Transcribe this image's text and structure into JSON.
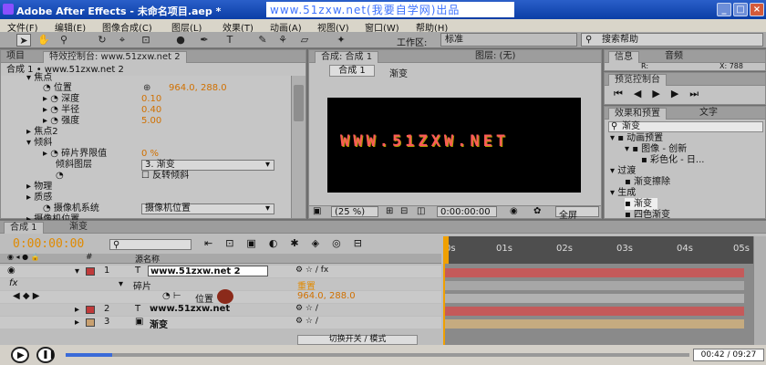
{
  "titlebar": {
    "title": "Adobe After Effects - 未命名项目.aep *",
    "watermark": "www.51zxw.net(我要自学网)出品",
    "buttons": [
      "_",
      "□",
      "×"
    ]
  },
  "menu": [
    "文件(F)",
    "编辑(E)",
    "图像合成(C)",
    "图层(L)",
    "效果(T)",
    "动画(A)",
    "视图(V)",
    "窗口(W)",
    "帮助(H)"
  ],
  "toolbar": {
    "workspace_label": "工作区:",
    "workspace_value": "标准",
    "search_help": "搜索帮助"
  },
  "left_panel": {
    "tabs": [
      "项目",
      "特效控制台: www.51zxw.net 2"
    ],
    "breadcrumb": "合成 1 • www.51zxw.net 2",
    "rows": [
      {
        "label": "焦点",
        "value": ""
      },
      {
        "label": "位置",
        "value": "964.0, 288.0"
      },
      {
        "label": "深度",
        "value": "0.10"
      },
      {
        "label": "半径",
        "value": "0.40"
      },
      {
        "label": "强度",
        "value": "5.00"
      },
      {
        "label": "焦点2",
        "value": ""
      },
      {
        "label": "倾斜",
        "value": ""
      },
      {
        "label": "碎片界限值",
        "value": "0 %"
      },
      {
        "label": "倾斜图层",
        "value": "3. 渐变"
      },
      {
        "label": "反转倾斜",
        "value": ""
      },
      {
        "label": "物理",
        "value": ""
      },
      {
        "label": "质感",
        "value": ""
      },
      {
        "label": "摄像机系统",
        "value": "摄像机位置"
      },
      {
        "label": "摄像机位置",
        "value": ""
      }
    ]
  },
  "comp_panel": {
    "tabs": [
      "合成: 合成 1",
      "图层: (无)"
    ],
    "subtabs": [
      "合成 1",
      "渐变"
    ],
    "canvas_text": "WWW.51ZXW.NET",
    "zoom": "(25 %)",
    "timecode": "0:00:00:00",
    "view": "全屏"
  },
  "right_panel": {
    "info_tabs": [
      "信息",
      "音频"
    ],
    "info_r": "R:",
    "info_x": "X: 788",
    "preview_tab": "预览控制台",
    "effects_tabs": [
      "效果和预置",
      "文字"
    ],
    "search_value": "渐变",
    "tree": [
      {
        "label": "动画预置",
        "level": 1
      },
      {
        "label": "图像 - 创新",
        "level": 2
      },
      {
        "label": "彩色化 - 日...",
        "level": 3
      },
      {
        "label": "过渡",
        "level": 1
      },
      {
        "label": "渐变擦除",
        "level": 2
      },
      {
        "label": "生成",
        "level": 1
      },
      {
        "label": "渐变",
        "level": 2
      },
      {
        "label": "四色渐变",
        "level": 2
      }
    ]
  },
  "timeline": {
    "tabs": [
      "合成 1",
      "渐变"
    ],
    "timecode": "0:00:00:00",
    "col_source": "源名称",
    "ruler": [
      "0s",
      "01s",
      "02s",
      "03s",
      "04s",
      "05s"
    ],
    "layers": [
      {
        "num": "1",
        "name": "www.51zxw.net 2",
        "color": "#c03a3a"
      },
      {
        "num": "",
        "name": "碎片",
        "color": ""
      },
      {
        "num": "",
        "name": "位置",
        "color": "",
        "value": "964.0, 288.0",
        "value_label": "重置"
      },
      {
        "num": "2",
        "name": "www.51zxw.net",
        "color": "#c03a3a"
      },
      {
        "num": "3",
        "name": "渐变",
        "color": "#c8a070"
      }
    ],
    "toggle_label": "切换开关 / 模式"
  },
  "player": {
    "time": "00:42 / 09:27",
    "progress": 0.074
  }
}
